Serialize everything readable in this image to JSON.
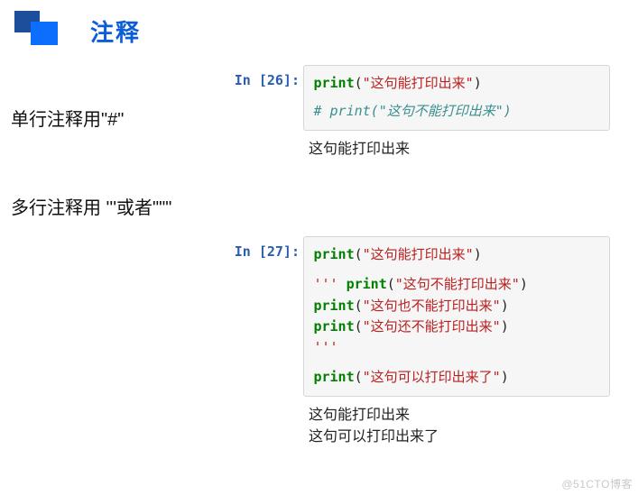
{
  "header": {
    "title": "注释"
  },
  "descriptions": {
    "single_line": "单行注释用\"#\"",
    "multi_line": "多行注释用 '''或者\"\"\""
  },
  "cells": [
    {
      "prompt": "In [26]:",
      "code": {
        "line1": {
          "fn": "print",
          "open": "(",
          "str": "\"这句能打印出来\"",
          "close": ")"
        },
        "comment": "# print(\"这句不能打印出来\")"
      },
      "output": "这句能打印出来"
    },
    {
      "prompt": "In [27]:",
      "code": {
        "line1": {
          "fn": "print",
          "open": "(",
          "str": "\"这句能打印出来\"",
          "close": ")"
        },
        "block_open": "''' ",
        "block_fn1": "print",
        "block_open1": "(",
        "block_str1": "\"这句不能打印出来\"",
        "block_close1": ")",
        "block_fn2": "print",
        "block_open2": "(",
        "block_str2": "\"这句也不能打印出来\"",
        "block_close2": ")",
        "block_fn3": "print",
        "block_open3": "(",
        "block_str3": "\"这句还不能打印出来\"",
        "block_close3": ")",
        "block_end": "'''",
        "line_last": {
          "fn": "print",
          "open": "(",
          "str": "\"这句可以打印出来了\"",
          "close": ")"
        }
      },
      "output": "这句能打印出来\n这句可以打印出来了"
    }
  ],
  "watermark": "@51CTO博客"
}
